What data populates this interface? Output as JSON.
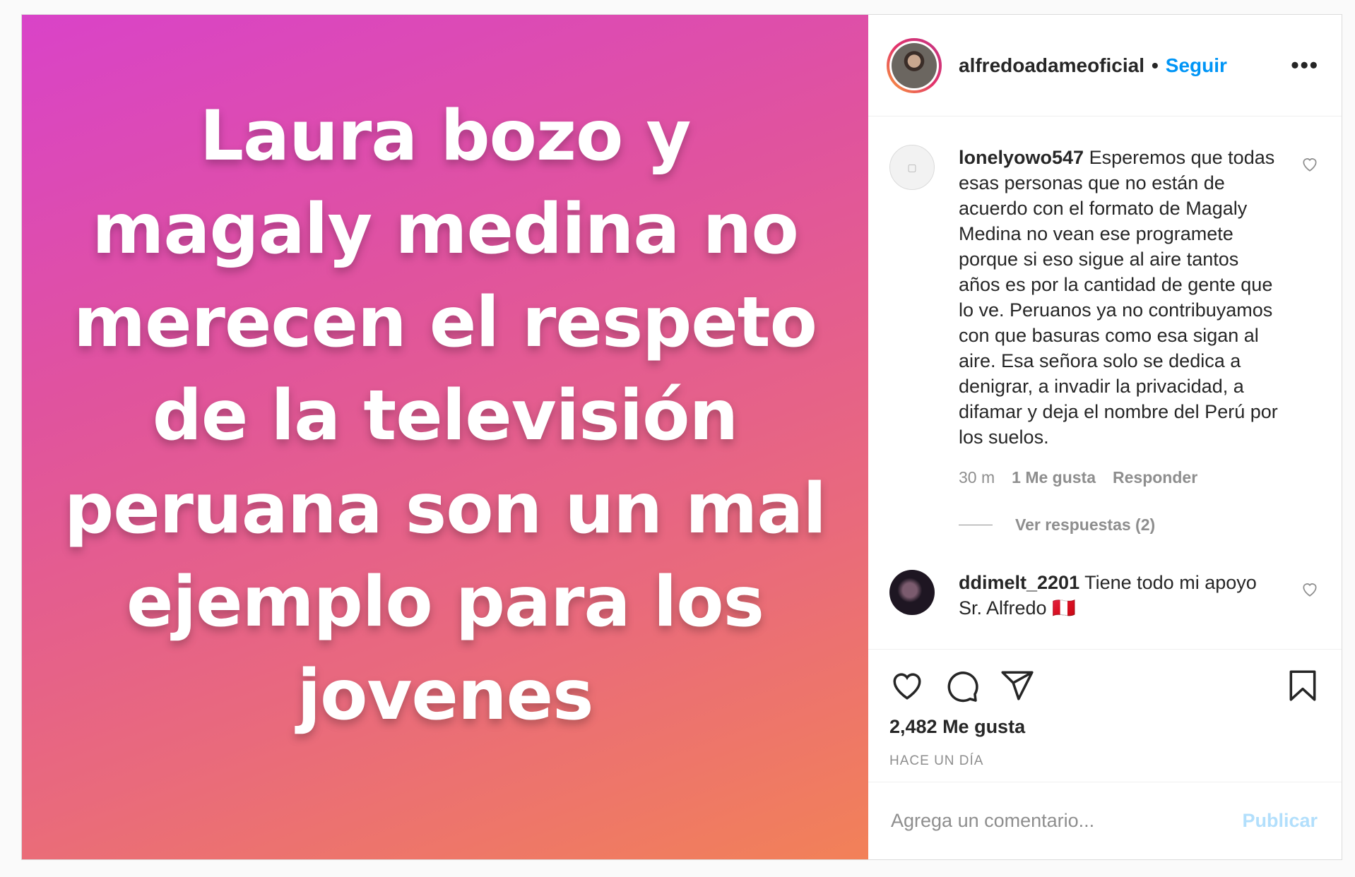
{
  "post": {
    "image_text": "Laura bozo y magaly medina no merecen el respeto de la televisión peruana son un mal ejemplo para los jovenes"
  },
  "header": {
    "username": "alfredoadameoficial",
    "separator": "•",
    "follow_label": "Seguir",
    "more_icon": "more-options-icon",
    "more_label": "•••"
  },
  "comments": [
    {
      "username": "lonelyowo547",
      "text": "Esperemos que todas esas personas que no están de acuerdo con el formato de Magaly Medina no vean ese programete porque si eso sigue al aire tantos años es por la cantidad de gente que lo ve. Peruanos ya no contribuyamos con que basuras como esa sigan al aire. Esa señora solo se dedica a denigrar, a invadir la privacidad, a difamar y deja el nombre del Perú por los suelos.",
      "time": "30 m",
      "likes": "1 Me gusta",
      "reply_label": "Responder",
      "view_replies": "Ver respuestas (2)"
    },
    {
      "username": "ddimelt_2201",
      "text": "Tiene todo mi apoyo Sr. Alfredo",
      "flag": "🇵🇪"
    }
  ],
  "actions": {
    "like_icon": "heart-icon",
    "comment_icon": "comment-icon",
    "share_icon": "send-icon",
    "save_icon": "bookmark-icon",
    "likes_count": "2,482 Me gusta",
    "timestamp": "HACE UN DÍA"
  },
  "add_comment": {
    "placeholder": "Agrega un comentario...",
    "publish_label": "Publicar"
  },
  "colors": {
    "accent": "#0095f6",
    "publish_disabled": "#b2dffc",
    "muted": "#8e8e8e",
    "gradient_start": "#d943c8",
    "gradient_end": "#f28158"
  }
}
